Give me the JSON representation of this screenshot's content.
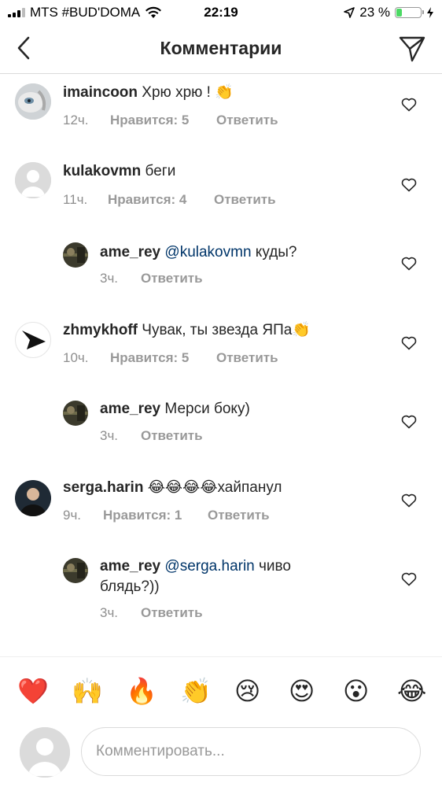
{
  "status_bar": {
    "carrier": "MTS #BUD'DOMA",
    "time": "22:19",
    "battery": "23 %",
    "battery_level": 0.23
  },
  "header": {
    "title": "Комментарии"
  },
  "comments": [
    {
      "user": "imaincoon",
      "text": "Хрю хрю ! 👏",
      "time": "12ч.",
      "likes": "Нравится: 5",
      "reply": "Ответить"
    },
    {
      "user": "kulakovmn",
      "text": "беги",
      "time": "11ч.",
      "likes": "Нравится: 4",
      "reply": "Ответить"
    },
    {
      "user": "ame_rey",
      "mention": "@kulakovmn",
      "text": "куды?",
      "time": "3ч.",
      "reply": "Ответить"
    },
    {
      "user": "zhmykhoff",
      "text": "Чувак, ты звезда ЯПа👏",
      "time": "10ч.",
      "likes": "Нравится: 5",
      "reply": "Ответить"
    },
    {
      "user": "ame_rey",
      "text": "Мерси боку)",
      "time": "3ч.",
      "reply": "Ответить"
    },
    {
      "user": "serga.harin",
      "text": "😂😂😂😂хайпанул",
      "time": "9ч.",
      "likes": "Нравится: 1",
      "reply": "Ответить"
    },
    {
      "user": "ame_rey",
      "mention": "@serga.harin",
      "text": "чиво",
      "text2": "блядь?))",
      "time": "3ч.",
      "reply": "Ответить"
    }
  ],
  "emoji_bar": [
    "❤️",
    "🙌",
    "🔥",
    "👏",
    "😢",
    "😍",
    "😮",
    "😂"
  ],
  "composer": {
    "placeholder": "Комментировать..."
  },
  "icons": {
    "back": "chevron-left-icon",
    "send": "paper-plane-icon",
    "heart": "heart-outline-icon"
  },
  "colors": {
    "mention": "#003569",
    "meta": "#8e8e8e",
    "battery": "#4cd964"
  }
}
